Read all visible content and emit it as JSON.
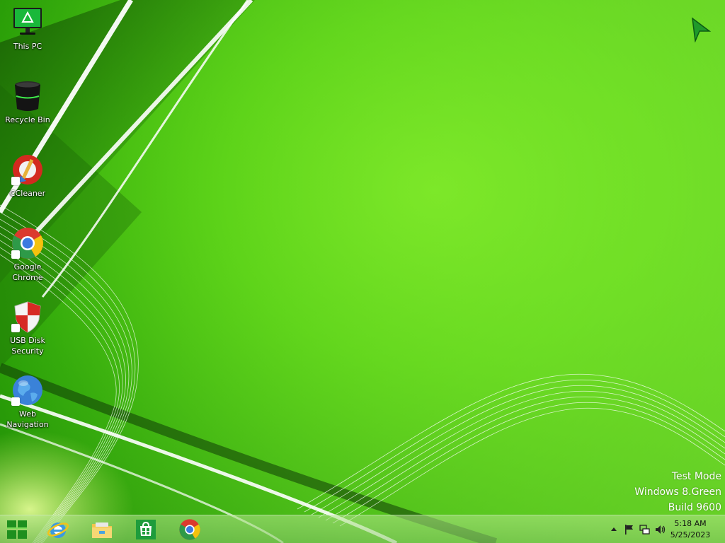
{
  "desktop": {
    "icons": [
      {
        "label": "This PC",
        "icon": "computer-monitor-icon"
      },
      {
        "label": "Recycle Bin",
        "icon": "recycle-bin-icon"
      },
      {
        "label": "CCleaner",
        "icon": "ccleaner-icon"
      },
      {
        "label": "Google\nChrome",
        "icon": "chrome-icon"
      },
      {
        "label": "USB Disk\nSecurity",
        "icon": "shield-icon"
      },
      {
        "label": "Web\nNavigation",
        "icon": "globe-icon"
      }
    ]
  },
  "watermark": {
    "line1": "Test Mode",
    "line2": "Windows 8.Green",
    "line3": "Build 9600"
  },
  "taskbar": {
    "buttons": [
      {
        "icon": "windows-start-icon"
      },
      {
        "icon": "internet-explorer-icon"
      },
      {
        "icon": "file-explorer-icon"
      },
      {
        "icon": "store-icon"
      },
      {
        "icon": "chrome-icon"
      }
    ],
    "tray": {
      "icons": [
        "chevron-up-icon",
        "flag-icon",
        "network-icon",
        "volume-icon"
      ]
    },
    "clock": {
      "time": "5:18 AM",
      "date": "5/25/2023"
    }
  },
  "colors": {
    "wallpaper_green": "#4fcc0f",
    "accent_green": "#1f9a2a",
    "label_text": "#ffffff",
    "tray_text": "#111111"
  }
}
